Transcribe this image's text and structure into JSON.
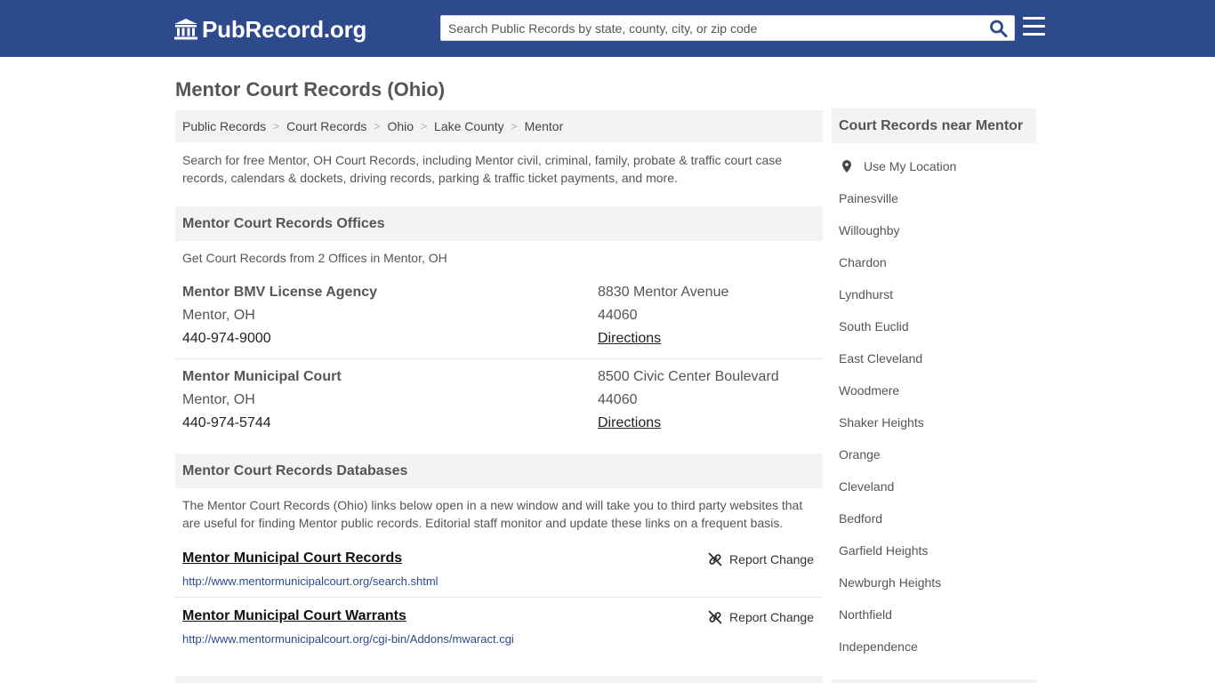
{
  "header": {
    "logo_text": "PubRecord.org",
    "search_placeholder": "Search Public Records by state, county, city, or zip code",
    "brand_color": "#2c4a8c"
  },
  "page_title": "Mentor Court Records (Ohio)",
  "breadcrumb": [
    "Public Records",
    "Court Records",
    "Ohio",
    "Lake County",
    "Mentor"
  ],
  "intro": "Search for free Mentor, OH Court Records, including Mentor civil, criminal, family, probate & traffic court case records, calendars & dockets, driving records, parking & traffic ticket payments, and more.",
  "offices_section": {
    "heading": "Mentor Court Records Offices",
    "subtext": "Get Court Records from 2 Offices in Mentor, OH",
    "offices": [
      {
        "name": "Mentor BMV License Agency",
        "city": "Mentor, OH",
        "phone": "440-974-9000",
        "address": "8830 Mentor Avenue",
        "zip": "44060",
        "directions": "Directions"
      },
      {
        "name": "Mentor Municipal Court",
        "city": "Mentor, OH",
        "phone": "440-974-5744",
        "address": "8500 Civic Center Boulevard",
        "zip": "44060",
        "directions": "Directions"
      }
    ]
  },
  "databases_section": {
    "heading": "Mentor Court Records Databases",
    "intro": "The Mentor Court Records (Ohio) links below open in a new window and will take you to third party websites that are useful for finding Mentor public records. Editorial staff monitor and update these links on a frequent basis.",
    "links": [
      {
        "title": "Mentor Municipal Court Records",
        "url": "http://www.mentormunicipalcourt.org/search.shtml",
        "report": "Report Change"
      },
      {
        "title": "Mentor Municipal Court Warrants",
        "url": "http://www.mentormunicipalcourt.org/cgi-bin/Addons/mwaract.cgi",
        "report": "Report Change"
      }
    ]
  },
  "sidebar": {
    "heading": "Court Records near Mentor",
    "use_location": "Use My Location",
    "cities": [
      "Painesville",
      "Willoughby",
      "Chardon",
      "Lyndhurst",
      "South Euclid",
      "East Cleveland",
      "Woodmere",
      "Shaker Heights",
      "Orange",
      "Cleveland",
      "Bedford",
      "Garfield Heights",
      "Newburgh Heights",
      "Northfield",
      "Independence"
    ]
  },
  "icons": {
    "logo": "courthouse-icon",
    "search": "search-icon",
    "menu": "hamburger-menu-icon",
    "location": "map-pin-icon",
    "report": "broken-link-icon"
  }
}
